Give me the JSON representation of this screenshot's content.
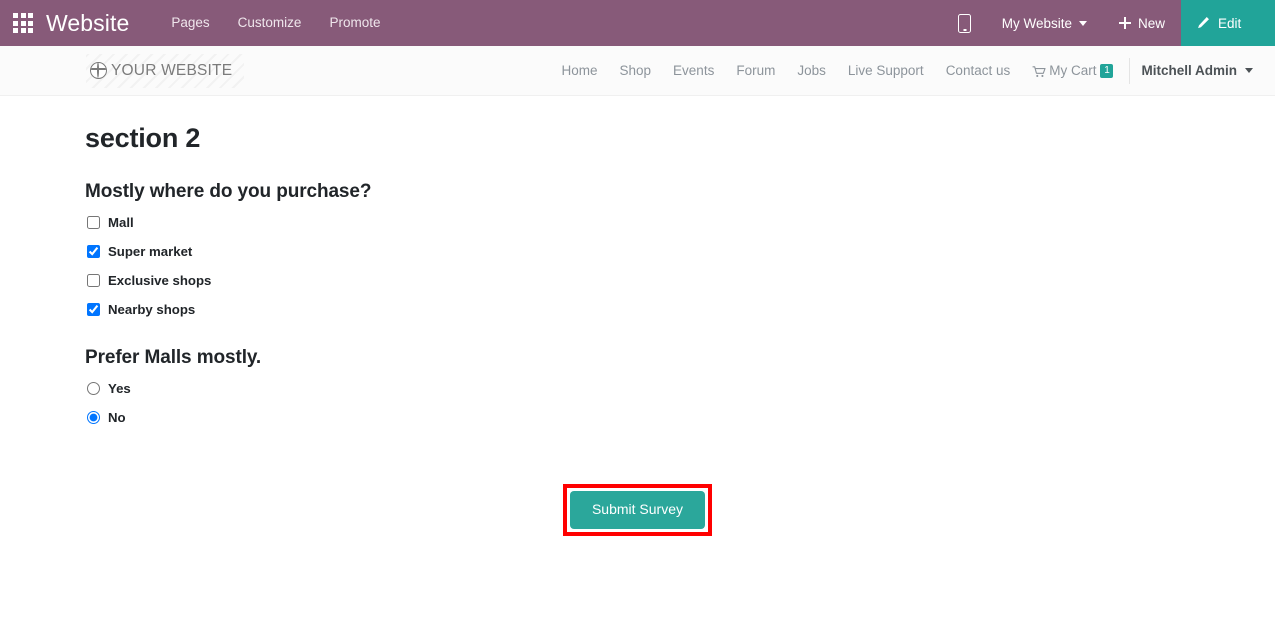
{
  "backend_bar": {
    "apps_icon": "grid-apps-icon",
    "brand": "Website",
    "menu_items": [
      {
        "label": "Pages"
      },
      {
        "label": "Customize"
      },
      {
        "label": "Promote"
      }
    ],
    "mobile_preview_icon": "mobile-phone-icon",
    "website_selector": "My Website",
    "new_button": "New",
    "edit_button": "Edit",
    "colors": {
      "bar_background": "#875A79",
      "edit_background": "#21A499"
    }
  },
  "website_nav": {
    "logo_text": "YOUR WEBSITE",
    "logo_icon": "globe-icon",
    "links": [
      {
        "label": "Home"
      },
      {
        "label": "Shop"
      },
      {
        "label": "Events"
      },
      {
        "label": "Forum"
      },
      {
        "label": "Jobs"
      },
      {
        "label": "Live Support"
      },
      {
        "label": "Contact us"
      }
    ],
    "cart": {
      "icon": "shopping-cart-icon",
      "label": "My Cart",
      "count": "1",
      "badge_color": "#21A499"
    },
    "user": {
      "name": "Mitchell Admin"
    }
  },
  "survey": {
    "section_title": "section 2",
    "questions": [
      {
        "title": "Mostly where do you purchase?",
        "type": "checkbox",
        "options": [
          {
            "label": "Mall",
            "checked": false
          },
          {
            "label": "Super market",
            "checked": true
          },
          {
            "label": "Exclusive shops",
            "checked": false
          },
          {
            "label": "Nearby shops",
            "checked": true
          }
        ]
      },
      {
        "title": "Prefer Malls mostly.",
        "type": "radio",
        "options": [
          {
            "label": "Yes",
            "checked": false
          },
          {
            "label": "No",
            "checked": true
          }
        ]
      }
    ],
    "submit_button": {
      "label": "Submit Survey",
      "background": "#2BA79B",
      "highlight_color": "#FF0000"
    }
  }
}
